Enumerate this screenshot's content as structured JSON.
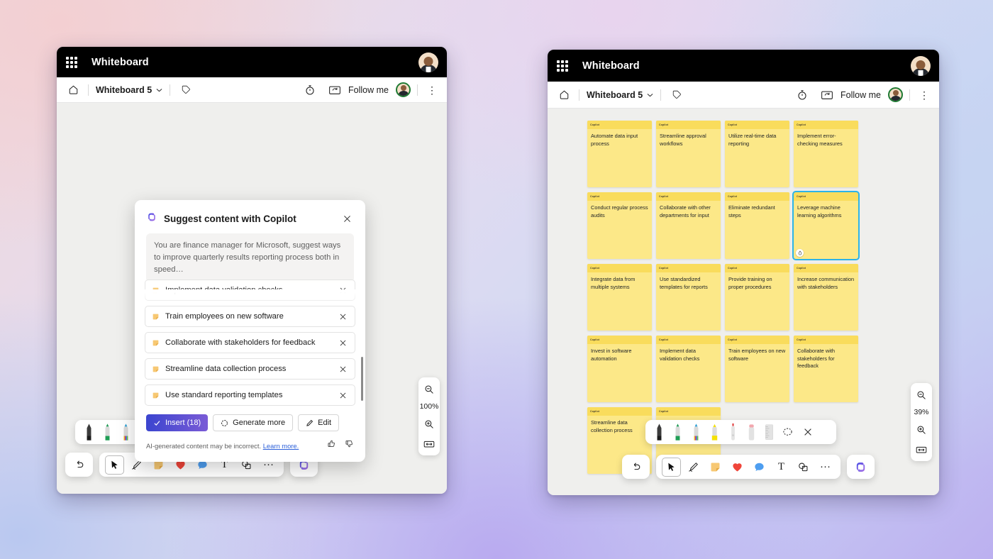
{
  "background": {
    "colors": [
      "#f0d8dc",
      "#e4dcf0",
      "#cdd8f4",
      "#bcb0f0"
    ]
  },
  "app": {
    "title": "Whiteboard",
    "waffle_icon": "app-launcher-icon",
    "account_icon": "account-avatar"
  },
  "subbar": {
    "home_icon": "home-icon",
    "board_name": "Whiteboard 5",
    "chevron_icon": "chevron-down-icon",
    "tag_icon": "tag-icon",
    "timer_icon": "timer-icon",
    "share_screen_icon": "present-icon",
    "follow_me": "Follow me",
    "presenter_icon": "presenter-avatar",
    "more_icon": "more-vertical-icon"
  },
  "left_window": {
    "zoom": {
      "level": "100%",
      "zoom_out_icon": "zoom-out-icon",
      "zoom_in_icon": "zoom-in-icon",
      "fit_icon": "fit-to-screen-icon"
    }
  },
  "right_window": {
    "zoom": {
      "level": "39%",
      "zoom_out_icon": "zoom-out-icon",
      "zoom_in_icon": "zoom-in-icon",
      "fit_icon": "fit-to-screen-icon"
    }
  },
  "copilot_dialog": {
    "icon": "copilot-icon",
    "title": "Suggest content with Copilot",
    "close_icon": "close-icon",
    "prompt_value": "You are finance manager for Microsoft, suggest ways to improve quarterly results reporting process both in speed…",
    "suggestions": [
      {
        "label": "Implement data validation checks",
        "remove_icon": "close-icon",
        "clipped": true
      },
      {
        "label": "Train employees on new software",
        "remove_icon": "close-icon"
      },
      {
        "label": "Collaborate with stakeholders for feedback",
        "remove_icon": "close-icon"
      },
      {
        "label": "Streamline data collection process",
        "remove_icon": "close-icon"
      },
      {
        "label": "Use standard reporting templates",
        "remove_icon": "close-icon"
      }
    ],
    "actions": {
      "insert_label": "Insert (18)",
      "insert_check_icon": "check-icon",
      "generate_label": "Generate more",
      "generate_icon": "refresh-icon",
      "edit_label": "Edit",
      "edit_icon": "pencil-icon"
    },
    "disclaimer": "AI-generated content may be incorrect.",
    "learn_more": "Learn more.",
    "thumbs_up_icon": "thumbs-up-icon",
    "thumbs_down_icon": "thumbs-down-icon",
    "primary_color": "#3b45cf",
    "link_color": "#2b5fd9"
  },
  "notes": {
    "header_label": "Copilot",
    "fill_color": "#fce888",
    "header_color": "#f9dc5c",
    "selection_color": "#2cb3e8",
    "items": [
      {
        "text": "Automate data input process",
        "selected": false
      },
      {
        "text": "Streamline approval workflows",
        "selected": false
      },
      {
        "text": "Utilize real-time data reporting",
        "selected": false
      },
      {
        "text": "Implement error-checking measures",
        "selected": false
      },
      {
        "text": "Conduct regular process audits",
        "selected": false
      },
      {
        "text": "Collaborate with other departments for input",
        "selected": false
      },
      {
        "text": "Eliminate redundant steps",
        "selected": false
      },
      {
        "text": "Leverage machine learning algorithms",
        "selected": true
      },
      {
        "text": "Integrate data from multiple systems",
        "selected": false
      },
      {
        "text": "Use standardized templates for reports",
        "selected": false
      },
      {
        "text": "Provide training on proper procedures",
        "selected": false
      },
      {
        "text": "Increase communication with stakeholders",
        "selected": false
      },
      {
        "text": "Invest in software automation",
        "selected": false
      },
      {
        "text": "Implement data validation checks",
        "selected": false
      },
      {
        "text": "Train employees on new software",
        "selected": false
      },
      {
        "text": "Collaborate with stakeholders for feedback",
        "selected": false
      },
      {
        "text": "Streamline data collection process",
        "selected": false
      },
      {
        "text": "Use standard reporting templates",
        "selected": false
      }
    ]
  },
  "pen_tray": {
    "pens": [
      {
        "name": "pen-black",
        "color": "#1c1c1c"
      },
      {
        "name": "pen-green",
        "color": "#1f9d55"
      },
      {
        "name": "pen-rainbow",
        "color": "#cc2f8f"
      },
      {
        "name": "highlighter-yellow",
        "color": "#f5e106"
      },
      {
        "name": "pen-thin-red",
        "color": "#e03a3a"
      },
      {
        "name": "eraser-pink",
        "color": "#f2a7ae"
      },
      {
        "name": "ruler",
        "color": "#d7d7d7"
      }
    ],
    "lasso_icon": "lasso-select-icon",
    "close_icon": "close-icon"
  },
  "toolbar": {
    "undo_icon": "undo-icon",
    "items": [
      {
        "name": "select-tool",
        "icon": "cursor-icon",
        "active": true
      },
      {
        "name": "ink-tool",
        "icon": "pen-icon",
        "active": false
      },
      {
        "name": "note-tool",
        "icon": "sticky-note-icon",
        "active": false
      },
      {
        "name": "reaction-tool",
        "icon": "heart-icon",
        "active": false
      },
      {
        "name": "comment-tool",
        "icon": "chat-bubble-icon",
        "active": false
      },
      {
        "name": "text-tool",
        "icon": "text-icon",
        "active": false
      },
      {
        "name": "shapes-tool",
        "icon": "shapes-icon",
        "active": false
      },
      {
        "name": "more-tools",
        "icon": "ellipsis-icon",
        "active": false
      }
    ],
    "copilot_icon": "copilot-icon"
  }
}
